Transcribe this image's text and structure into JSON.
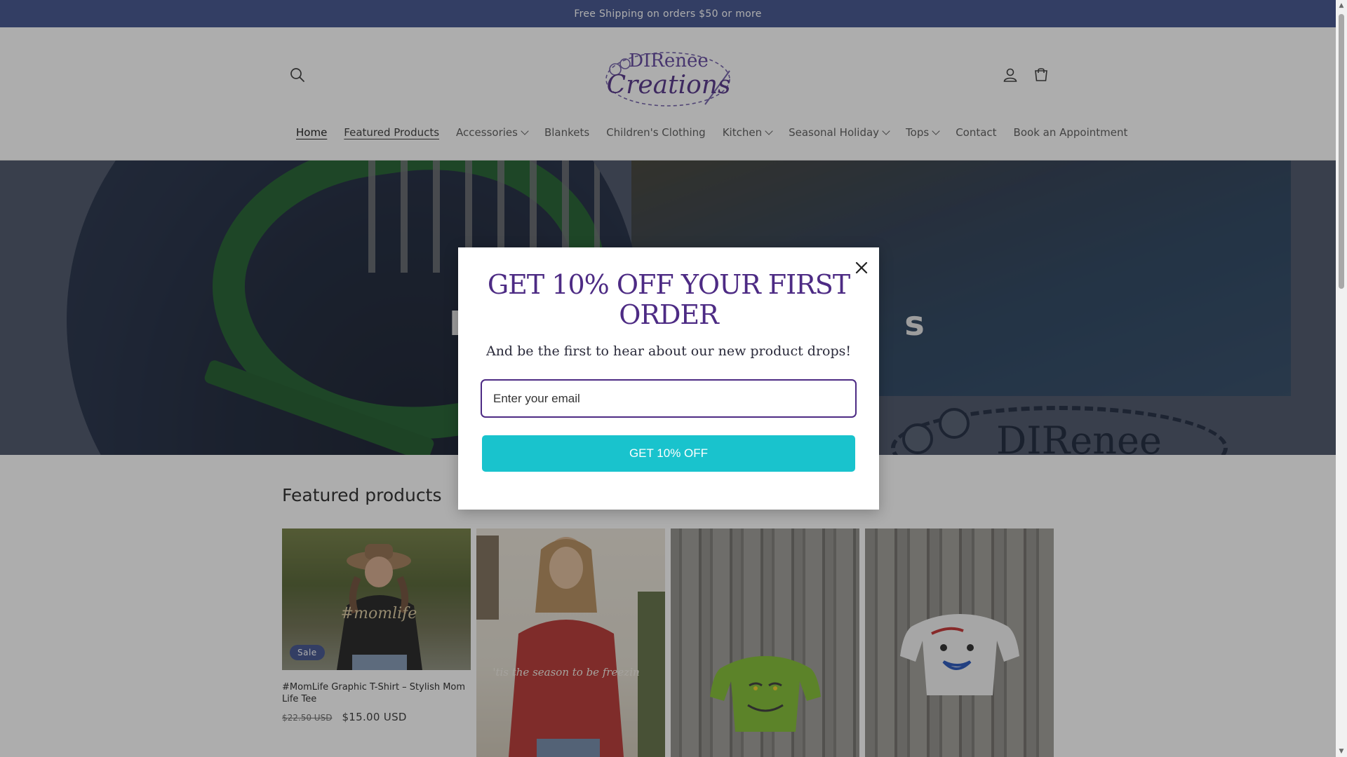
{
  "announcement": {
    "text": "Free Shipping on orders $50 or more"
  },
  "header": {
    "logo_text_line1": "DIRenee",
    "logo_text_line2": "Creations",
    "icons": {
      "search": "search-icon",
      "account": "account-icon",
      "cart": "cart-icon"
    }
  },
  "nav": {
    "items": [
      {
        "label": "Home",
        "dropdown": false
      },
      {
        "label": "Featured Products",
        "dropdown": false
      },
      {
        "label": "Accessories",
        "dropdown": true
      },
      {
        "label": "Blankets",
        "dropdown": false
      },
      {
        "label": "Children's Clothing",
        "dropdown": false
      },
      {
        "label": "Kitchen",
        "dropdown": true
      },
      {
        "label": "Seasonal Holiday",
        "dropdown": true
      },
      {
        "label": "Tops",
        "dropdown": true
      },
      {
        "label": "Contact",
        "dropdown": false
      },
      {
        "label": "Book an Appointment",
        "dropdown": false
      }
    ]
  },
  "hero": {
    "heading_left": "E",
    "heading_right": "s",
    "logo_text": "DIRenee"
  },
  "featured": {
    "title": "Featured products",
    "products": [
      {
        "title": "#MomLife Graphic T-Shirt – Stylish Mom Life Tee",
        "badge": "Sale",
        "price_old": "$22.50 USD",
        "price_new": "$15.00 USD",
        "shirt_text": "#momlife"
      },
      {
        "shirt_text": "'tis the season to be freezin"
      },
      {},
      {}
    ]
  },
  "modal": {
    "title": "GET 10% OFF YOUR FIRST ORDER",
    "subtitle": "And be the first to hear about our new product drops!",
    "email_placeholder": "Enter your email",
    "button_label": "GET 10% OFF"
  },
  "colors": {
    "announcement_bg": "#3a4c8a",
    "modal_title": "#4d2b84",
    "cta": "#19c3cd",
    "badge": "#3a4c8a"
  }
}
